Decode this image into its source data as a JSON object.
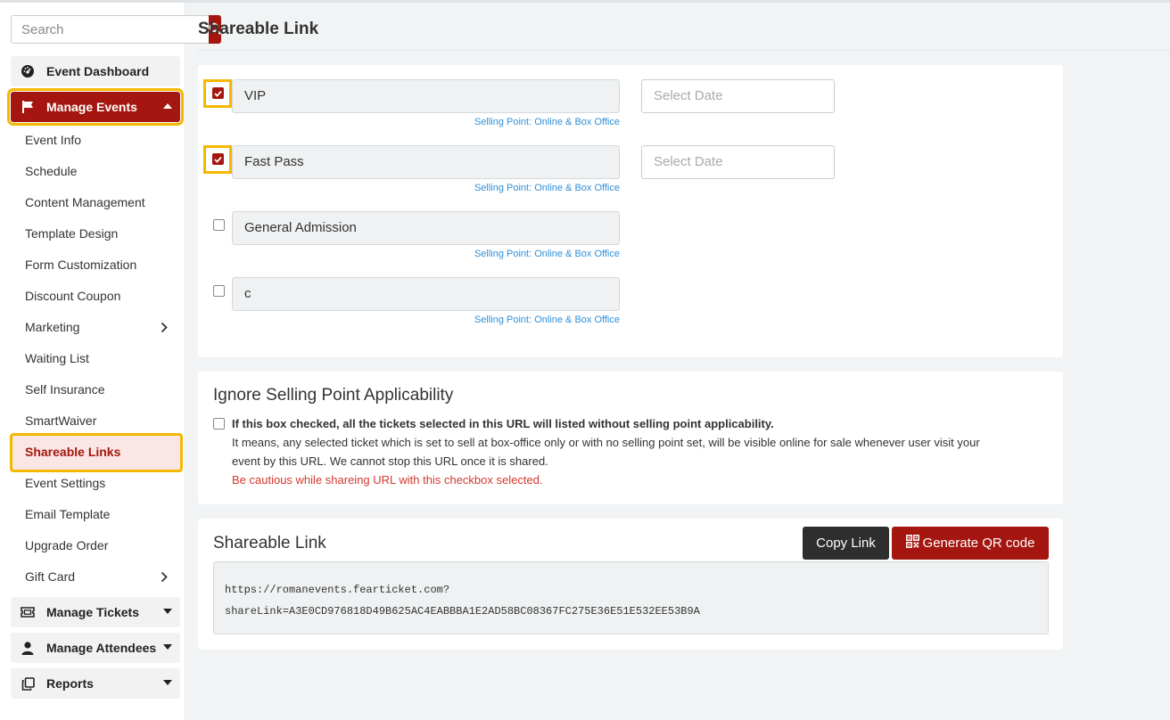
{
  "sidebar": {
    "search_placeholder": "Search",
    "event_dashboard": "Event Dashboard",
    "manage_events": "Manage Events",
    "sub_items": [
      "Event Info",
      "Schedule",
      "Content Management",
      "Template Design",
      "Form Customization",
      "Discount Coupon",
      "Marketing",
      "Waiting List",
      "Self Insurance",
      "SmartWaiver",
      "Shareable Links",
      "Event Settings",
      "Email Template",
      "Upgrade Order",
      "Gift Card"
    ],
    "active_sub_item": "Shareable Links",
    "manage_tickets": "Manage Tickets",
    "manage_attendees": "Manage Attendees",
    "reports": "Reports"
  },
  "header": {
    "title": "Shareable Link"
  },
  "tickets": [
    {
      "name": "VIP",
      "checked": true,
      "selling_point": "Selling Point: Online & Box Office",
      "date_placeholder": "Select Date"
    },
    {
      "name": "Fast Pass",
      "checked": true,
      "selling_point": "Selling Point: Online & Box Office",
      "date_placeholder": "Select Date"
    },
    {
      "name": "General Admission",
      "checked": false,
      "selling_point": "Selling Point: Online & Box Office"
    },
    {
      "name": "c",
      "checked": false,
      "selling_point": "Selling Point: Online & Box Office"
    }
  ],
  "ignore_section": {
    "title": "Ignore Selling Point Applicability",
    "bold_text": "If this box checked, all the tickets selected in this URL will listed without selling point applicability.",
    "line2": "It means, any selected ticket which is set to sell at box-office only or with no selling point set, will be visible online for sale whenever user visit your",
    "line3": "event by this URL. We cannot stop this URL once it is shared.",
    "warning": "Be cautious while shareing URL with this checkbox selected.",
    "checked": false
  },
  "link_section": {
    "title": "Shareable Link",
    "copy_label": "Copy Link",
    "qr_label": "Generate QR code",
    "url_line1": "https://romanevents.fearticket.com?",
    "url_line2": "shareLink=A3E0CD976818D49B625AC4EABBBA1E2AD58BC08367FC275E36E51E532EE53B9A"
  },
  "colors": {
    "brand": "#a4160f",
    "highlight": "#f5b800",
    "link_blue": "#2f8fd8",
    "warning": "#d23a2e"
  }
}
